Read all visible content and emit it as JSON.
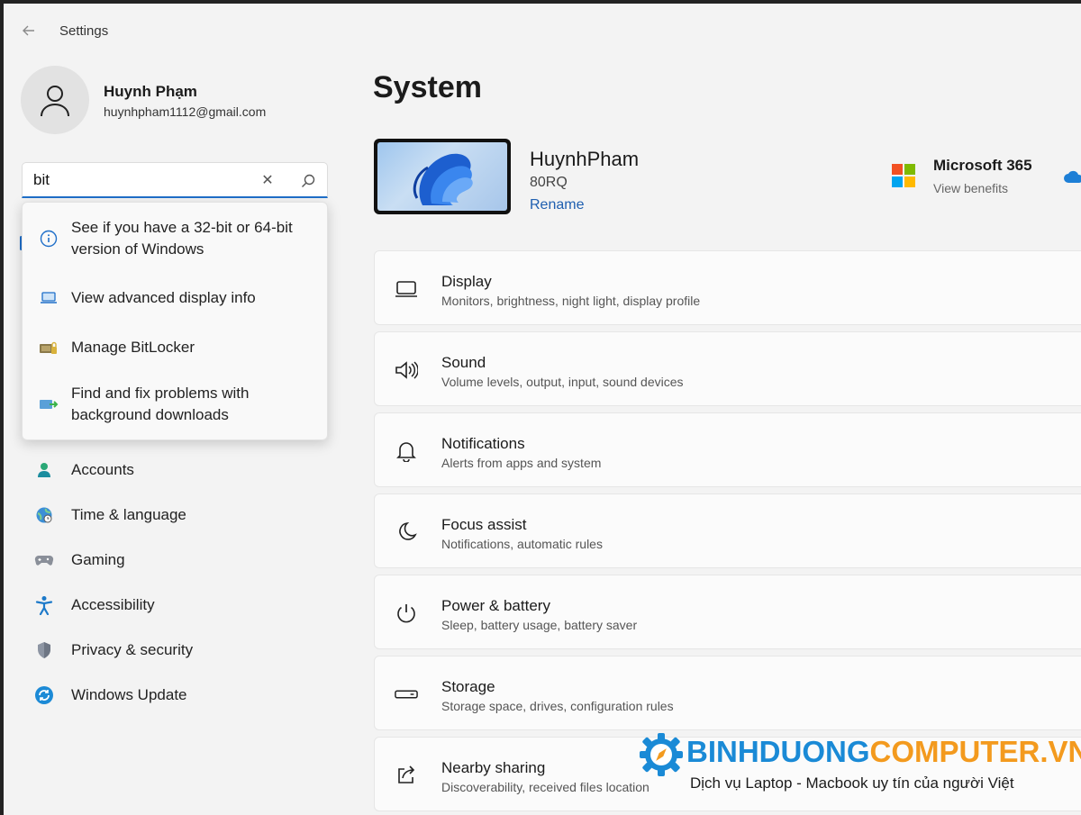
{
  "window": {
    "title": "Settings"
  },
  "profile": {
    "name": "Huynh Phạm",
    "email": "huynhpham1112@gmail.com"
  },
  "search": {
    "value": "bit"
  },
  "suggestions": [
    {
      "icon": "info-icon",
      "text": "See if you have a 32-bit or 64-bit version of Windows"
    },
    {
      "icon": "laptop-icon",
      "text": "View advanced display info"
    },
    {
      "icon": "bitlocker-icon",
      "text": "Manage BitLocker"
    },
    {
      "icon": "download-troubleshoot-icon",
      "text": "Find and fix problems with background downloads"
    }
  ],
  "nav": [
    {
      "id": "accounts",
      "icon": "person-icon",
      "label": "Accounts"
    },
    {
      "id": "time-language",
      "icon": "globe-clock-icon",
      "label": "Time & language"
    },
    {
      "id": "gaming",
      "icon": "gamepad-icon",
      "label": "Gaming"
    },
    {
      "id": "accessibility",
      "icon": "accessibility-icon",
      "label": "Accessibility"
    },
    {
      "id": "privacy-security",
      "icon": "shield-icon",
      "label": "Privacy & security"
    },
    {
      "id": "windows-update",
      "icon": "update-icon",
      "label": "Windows Update"
    }
  ],
  "main": {
    "title": "System",
    "device": {
      "name": "HuynhPham",
      "model": "80RQ",
      "rename_label": "Rename"
    },
    "ms365": {
      "title": "Microsoft 365",
      "subtitle": "View benefits"
    }
  },
  "cards": [
    {
      "id": "display",
      "icon": "monitor-icon",
      "title": "Display",
      "subtitle": "Monitors, brightness, night light, display profile"
    },
    {
      "id": "sound",
      "icon": "speaker-icon",
      "title": "Sound",
      "subtitle": "Volume levels, output, input, sound devices"
    },
    {
      "id": "notifications",
      "icon": "bell-icon",
      "title": "Notifications",
      "subtitle": "Alerts from apps and system"
    },
    {
      "id": "focus-assist",
      "icon": "moon-icon",
      "title": "Focus assist",
      "subtitle": "Notifications, automatic rules"
    },
    {
      "id": "power-battery",
      "icon": "power-icon",
      "title": "Power & battery",
      "subtitle": "Sleep, battery usage, battery saver"
    },
    {
      "id": "storage",
      "icon": "drive-icon",
      "title": "Storage",
      "subtitle": "Storage space, drives, configuration rules"
    },
    {
      "id": "nearby-sharing",
      "icon": "share-icon",
      "title": "Nearby sharing",
      "subtitle": "Discoverability, received files location"
    }
  ],
  "watermark": {
    "brand_part1": "BINHDUONG",
    "brand_part2": "COMPUTER.VN",
    "tagline": "Dịch vụ Laptop - Macbook uy tín của người Việt"
  },
  "colors": {
    "accent": "#1f6fc9",
    "brand_blue": "#1a8ad6",
    "brand_orange": "#f39a1e"
  }
}
